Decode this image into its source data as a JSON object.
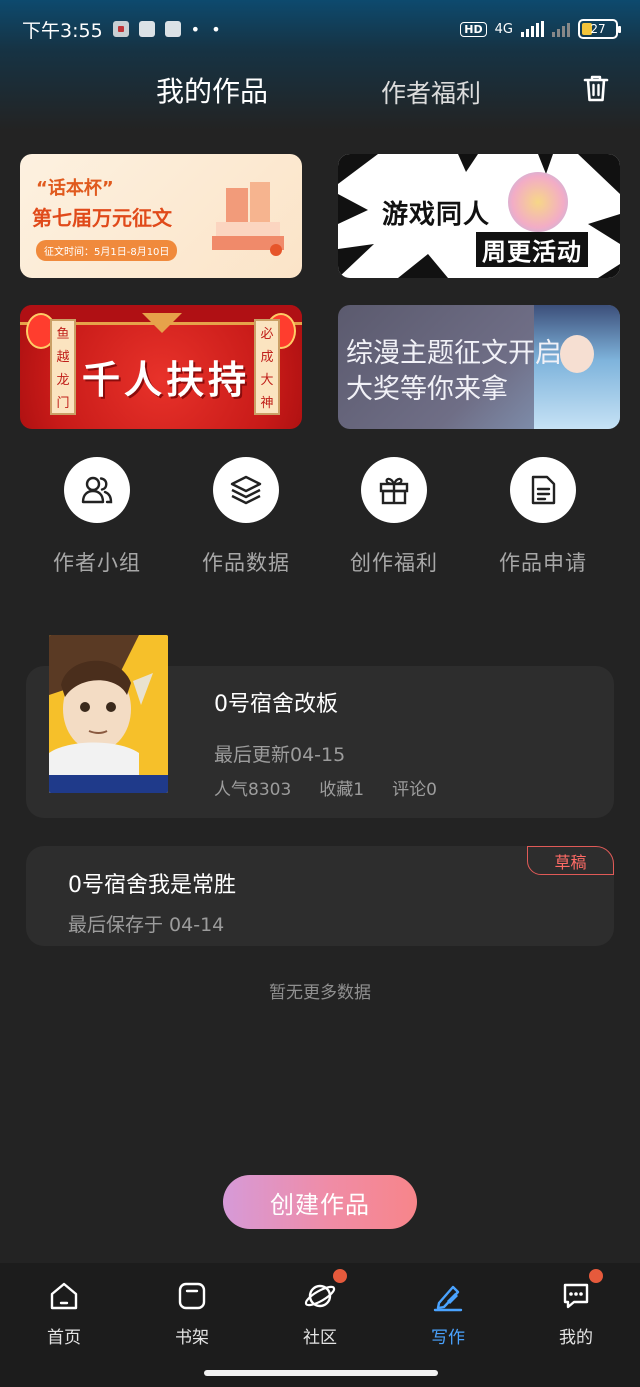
{
  "status_bar": {
    "time": "下午3:55",
    "dots": "• •",
    "network_type": "4G",
    "hd_label": "HD",
    "battery": "27"
  },
  "header": {
    "tab_works": "我的作品",
    "tab_benefits": "作者福利",
    "trash_icon": "trash-icon"
  },
  "banners": [
    {
      "line1": "“话本杯”",
      "line2": "第七届万元征文",
      "pill": "征文时间：5月1日-8月10日"
    },
    {
      "line1": "游戏同人",
      "line2": "周更活动"
    },
    {
      "title": "千人扶持",
      "left_scroll": [
        "鱼",
        "越",
        "龙",
        "门"
      ],
      "right_scroll": [
        "必",
        "成",
        "大",
        "神"
      ]
    },
    {
      "line1": "综漫主题征文开启",
      "line2": "大奖等你来拿"
    }
  ],
  "quick_actions": [
    {
      "label": "作者小组",
      "icon": "users-icon"
    },
    {
      "label": "作品数据",
      "icon": "layers-icon"
    },
    {
      "label": "创作福利",
      "icon": "gift-icon"
    },
    {
      "label": "作品申请",
      "icon": "document-icon"
    }
  ],
  "work": {
    "title": "0号宿舍改板",
    "updated": "最后更新04-15",
    "popularity": "人气8303",
    "favorites": "收藏1",
    "comments": "评论0"
  },
  "draft": {
    "title": "0号宿舍我是常胜",
    "saved": "最后保存于 04-14",
    "badge": "草稿"
  },
  "no_more": "暂无更多数据",
  "create_button": "创建作品",
  "bottom_nav": [
    {
      "label": "首页",
      "icon": "home-icon",
      "badge": false
    },
    {
      "label": "书架",
      "icon": "bookshelf-icon",
      "badge": false
    },
    {
      "label": "社区",
      "icon": "planet-icon",
      "badge": true
    },
    {
      "label": "写作",
      "icon": "pen-icon",
      "badge": false,
      "active": true
    },
    {
      "label": "我的",
      "icon": "chat-bubble-icon",
      "badge": true
    }
  ],
  "colors": {
    "background": "#232323",
    "card": "#2d2d2d",
    "active_tab": "#4aa3ff",
    "badge_red": "#e65a3c",
    "draft_badge": "#ff6b66"
  }
}
